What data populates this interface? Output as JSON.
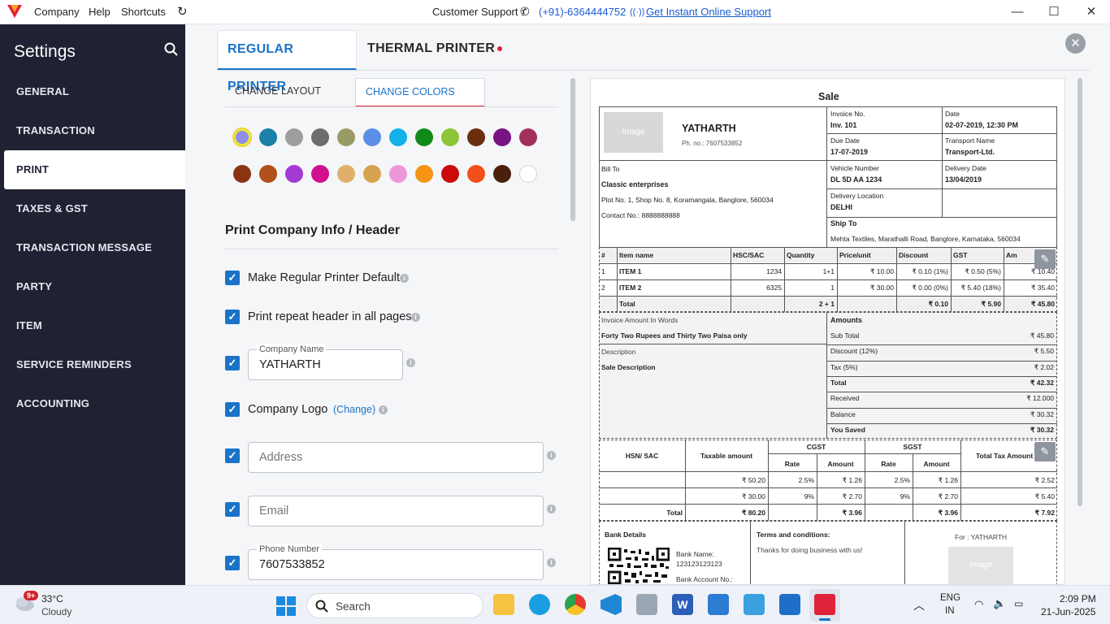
{
  "titlebar": {
    "menu": [
      "Company",
      "Help",
      "Shortcuts"
    ],
    "support_label": "Customer Support :",
    "support_phone": "(+91)-6364444752",
    "support_link": "Get Instant Online Support"
  },
  "sidebar": {
    "title": "Settings",
    "items": [
      "GENERAL",
      "TRANSACTION",
      "PRINT",
      "TAXES & GST",
      "TRANSACTION MESSAGE",
      "PARTY",
      "ITEM",
      "SERVICE REMINDERS",
      "ACCOUNTING"
    ],
    "active": "PRINT"
  },
  "tabs": {
    "regular": "REGULAR PRINTER",
    "thermal": "THERMAL PRINTER"
  },
  "subtabs": {
    "layout": "CHANGE LAYOUT",
    "colors": "CHANGE COLORS"
  },
  "colors": {
    "row1": [
      "#8e8ee6",
      "#1b7fa8",
      "#9e9e9e",
      "#6d6d6d",
      "#9a9a66",
      "#5b8ee6",
      "#10b2e8",
      "#128a1a",
      "#8cc43a",
      "#6b2e0e",
      "#7a1383",
      "#a3305c"
    ],
    "row2": [
      "#8b3414",
      "#b34f1b",
      "#a43ad6",
      "#d1108f",
      "#e0b06a",
      "#d6a450",
      "#ec98d8",
      "#f59413",
      "#c90b0b",
      "#f34f1a",
      "#4a1f0c",
      "#ffffff"
    ],
    "selected_index": 0,
    "accent": "#1a73c8",
    "alert": "#e0223a"
  },
  "section": {
    "title": "Print Company Info / Header"
  },
  "options": {
    "default": "Make Regular Printer Default",
    "repeat": "Print repeat header in all pages",
    "company_name_label": "Company Name",
    "company_name_value": "YATHARTH",
    "logo": "Company Logo",
    "logo_change": "(Change)",
    "address_ph": "Address",
    "email_ph": "Email",
    "phone_label": "Phone Number",
    "phone_value": "7607533852"
  },
  "invoice": {
    "heading": "Sale",
    "image_ph": "Image",
    "company": "YATHARTH",
    "phone": "Ph. no.: 7607533852",
    "inv_no_label": "Invoice No.",
    "inv_no": "Inv. 101",
    "date_label": "Date",
    "date": "02-07-2019, 12:30 PM",
    "due_label": "Due Date",
    "due": "17-07-2019",
    "transport_label": "Transport Name",
    "transport": "Transport-Ltd.",
    "billto_label": "Bill To",
    "party": "Classic enterprises",
    "party_addr": "Plot No. 1, Shop No. 8, Koramangala, Banglore, 560034",
    "party_contact": "Contact No.: 8888888888",
    "vehicle_label": "Vehicle Number",
    "vehicle": "DL 5D AA 1234",
    "delivery_date_label": "Delivery Date",
    "delivery_date": "13/04/2019",
    "delivery_loc_label": "Delivery Location",
    "delivery_loc": "DELHI",
    "shipto_label": "Ship To",
    "shipto": "Mehta Textiles, Marathalli Road, Banglore, Karnataka, 560034",
    "items_head": [
      "#",
      "Item name",
      "HSC/SAC",
      "Quantity",
      "Price/unit",
      "Discount",
      "GST",
      "Am"
    ],
    "items": [
      [
        "1",
        "ITEM 1",
        "1234",
        "1+1",
        "₹ 10.00",
        "₹ 0.10 (1%)",
        "₹ 0.50 (5%)",
        "₹ 10.40"
      ],
      [
        "2",
        "ITEM 2",
        "6325",
        "1",
        "₹ 30.00",
        "₹ 0.00 (0%)",
        "₹ 5.40 (18%)",
        "₹ 35.40"
      ]
    ],
    "items_total": [
      "",
      "Total",
      "",
      "2 + 1",
      "",
      "₹ 0.10",
      "₹ 5.90",
      "₹ 45.80"
    ],
    "words_label": "Invoice Amount In Words",
    "words": "Forty Two Rupees and Thirty Two Paisa only",
    "desc_label": "Description",
    "desc": "Sale Description",
    "amounts_label": "Amounts",
    "amounts": [
      [
        "Sub Total",
        "₹ 45.80"
      ],
      [
        "Discount (12%)",
        "₹ 5.50"
      ],
      [
        "Tax (5%)",
        "₹ 2.02"
      ],
      [
        "Total",
        "₹ 42.32"
      ],
      [
        "Received",
        "₹ 12.000"
      ],
      [
        "Balance",
        "₹ 30.32"
      ],
      [
        "You Saved",
        "₹ 30.32"
      ]
    ],
    "tax_head": {
      "hsn": "HSN/ SAC",
      "taxable": "Taxable amount",
      "cgst": "CGST",
      "sgst": "SGST",
      "rate": "Rate",
      "amount": "Amount",
      "total": "Total Tax Amount"
    },
    "tax_rows": [
      [
        "",
        "₹ 50.20",
        "2.5%",
        "₹ 1.26",
        "2.5%",
        "₹ 1.26",
        "₹ 2.52"
      ],
      [
        "",
        "₹ 30.00",
        "9%",
        "₹ 2.70",
        "9%",
        "₹ 2.70",
        "₹ 5.40"
      ],
      [
        "Total",
        "₹ 80.20",
        "",
        "₹ 3.96",
        "",
        "₹ 3.96",
        "₹ 7.92"
      ]
    ],
    "bank_label": "Bank Details",
    "bank_name": "Bank Name:",
    "bank_name_val": "123123123123",
    "bank_acc": "Bank Account No.:",
    "terms_label": "Terms and conditions:",
    "terms": "Thanks for doing business with us!",
    "for": "For : YATHARTH"
  },
  "taskbar": {
    "weather_temp": "33°C",
    "weather_desc": "Cloudy",
    "badge": "9+",
    "search": "Search",
    "lang1": "ENG",
    "lang2": "IN",
    "time": "2:09 PM",
    "date": "21-Jun-2025"
  }
}
